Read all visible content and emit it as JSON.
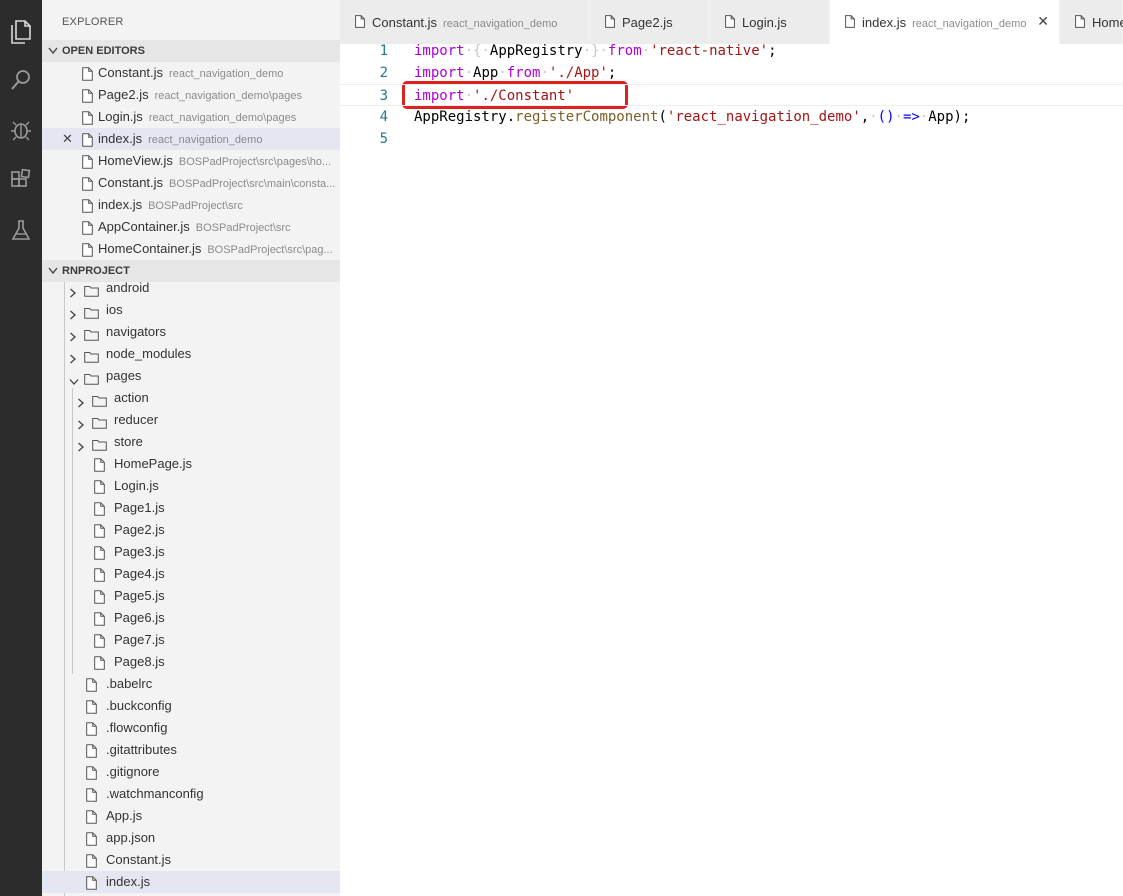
{
  "activity_bar": {
    "icons": [
      "files-icon",
      "search-icon",
      "debug-icon",
      "extensions-icon",
      "flask-icon"
    ]
  },
  "sidebar": {
    "title": "EXPLORER",
    "open_editors_header": "OPEN EDITORS",
    "open_editors": [
      {
        "name": "Constant.js",
        "desc": "react_navigation_demo",
        "selected": false
      },
      {
        "name": "Page2.js",
        "desc": "react_navigation_demo\\pages",
        "selected": false
      },
      {
        "name": "Login.js",
        "desc": "react_navigation_demo\\pages",
        "selected": false
      },
      {
        "name": "index.js",
        "desc": "react_navigation_demo",
        "selected": true
      },
      {
        "name": "HomeView.js",
        "desc": "BOSPadProject\\src\\pages\\ho...",
        "selected": false
      },
      {
        "name": "Constant.js",
        "desc": "BOSPadProject\\src\\main\\consta...",
        "selected": false
      },
      {
        "name": "index.js",
        "desc": "BOSPadProject\\src",
        "selected": false
      },
      {
        "name": "AppContainer.js",
        "desc": "BOSPadProject\\src",
        "selected": false
      },
      {
        "name": "HomeContainer.js",
        "desc": "BOSPadProject\\src\\pag...",
        "selected": false
      }
    ],
    "project_header": "RNPROJECT",
    "tree": [
      {
        "name": "android",
        "type": "folder",
        "depth": 0,
        "open": false
      },
      {
        "name": "ios",
        "type": "folder",
        "depth": 0,
        "open": false
      },
      {
        "name": "navigators",
        "type": "folder",
        "depth": 0,
        "open": false
      },
      {
        "name": "node_modules",
        "type": "folder",
        "depth": 0,
        "open": false
      },
      {
        "name": "pages",
        "type": "folder",
        "depth": 0,
        "open": true
      },
      {
        "name": "action",
        "type": "folder",
        "depth": 1,
        "open": false
      },
      {
        "name": "reducer",
        "type": "folder",
        "depth": 1,
        "open": false
      },
      {
        "name": "store",
        "type": "folder",
        "depth": 1,
        "open": false
      },
      {
        "name": "HomePage.js",
        "type": "file",
        "depth": 1
      },
      {
        "name": "Login.js",
        "type": "file",
        "depth": 1
      },
      {
        "name": "Page1.js",
        "type": "file",
        "depth": 1
      },
      {
        "name": "Page2.js",
        "type": "file",
        "depth": 1
      },
      {
        "name": "Page3.js",
        "type": "file",
        "depth": 1
      },
      {
        "name": "Page4.js",
        "type": "file",
        "depth": 1
      },
      {
        "name": "Page5.js",
        "type": "file",
        "depth": 1
      },
      {
        "name": "Page6.js",
        "type": "file",
        "depth": 1
      },
      {
        "name": "Page7.js",
        "type": "file",
        "depth": 1
      },
      {
        "name": "Page8.js",
        "type": "file",
        "depth": 1
      },
      {
        "name": ".babelrc",
        "type": "file",
        "depth": 0
      },
      {
        "name": ".buckconfig",
        "type": "file",
        "depth": 0
      },
      {
        "name": ".flowconfig",
        "type": "file",
        "depth": 0
      },
      {
        "name": ".gitattributes",
        "type": "file",
        "depth": 0
      },
      {
        "name": ".gitignore",
        "type": "file",
        "depth": 0
      },
      {
        "name": ".watchmanconfig",
        "type": "file",
        "depth": 0
      },
      {
        "name": "App.js",
        "type": "file",
        "depth": 0
      },
      {
        "name": "app.json",
        "type": "file",
        "depth": 0
      },
      {
        "name": "Constant.js",
        "type": "file",
        "depth": 0
      },
      {
        "name": "index.js",
        "type": "file",
        "depth": 0,
        "selected": true
      }
    ]
  },
  "tabs": [
    {
      "name": "Constant.js",
      "desc": "react_navigation_demo",
      "active": false
    },
    {
      "name": "Page2.js",
      "desc": "",
      "active": false
    },
    {
      "name": "Login.js",
      "desc": "",
      "active": false
    },
    {
      "name": "index.js",
      "desc": "react_navigation_demo",
      "active": true,
      "close": "✕"
    },
    {
      "name": "Home",
      "desc": "",
      "active": false
    }
  ],
  "editor": {
    "lines": [
      {
        "num": "1",
        "tokens": [
          [
            "kw",
            "import"
          ],
          [
            "ws",
            "·"
          ],
          [
            "ws",
            "{"
          ],
          [
            "ws",
            "·"
          ],
          [
            "",
            ""
          ],
          [
            "",
            "AppRegistry"
          ],
          [
            "ws",
            "·"
          ],
          [
            "ws",
            "}"
          ],
          [
            "ws",
            "·"
          ],
          [
            "kw",
            "from"
          ],
          [
            "ws",
            "·"
          ],
          [
            "str",
            "'react-native'"
          ],
          [
            "",
            ";"
          ]
        ]
      },
      {
        "num": "2",
        "tokens": [
          [
            "kw",
            "import"
          ],
          [
            "ws",
            "·"
          ],
          [
            "",
            "App"
          ],
          [
            "ws",
            "·"
          ],
          [
            "kw",
            "from"
          ],
          [
            "ws",
            "·"
          ],
          [
            "str",
            "'./App'"
          ],
          [
            "",
            ";"
          ]
        ]
      },
      {
        "num": "3",
        "tokens": [
          [
            "kw",
            "import"
          ],
          [
            "ws",
            "·"
          ],
          [
            "str",
            "'./Constant'"
          ]
        ]
      },
      {
        "num": "4",
        "tokens": [
          [
            "",
            "AppRegistry"
          ],
          [
            "",
            "."
          ],
          [
            "fn",
            "registerComponent"
          ],
          [
            "",
            "("
          ],
          [
            "str",
            "'react_navigation_demo'"
          ],
          [
            "",
            ","
          ],
          [
            "ws",
            "·"
          ],
          [
            "op",
            "()"
          ],
          [
            "ws",
            "·"
          ],
          [
            "op",
            "=>"
          ],
          [
            "ws",
            "·"
          ],
          [
            "",
            "App"
          ],
          [
            "",
            ");"
          ]
        ]
      },
      {
        "num": "5",
        "tokens": []
      }
    ]
  }
}
